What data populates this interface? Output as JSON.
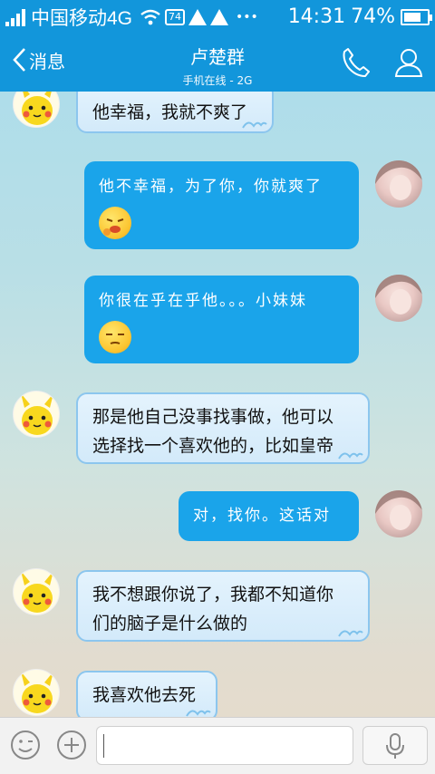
{
  "status_bar": {
    "carrier": "中国移动4G",
    "battery_icon_text": "74",
    "more": "•••",
    "time": "14:31",
    "battery_percent": "74%",
    "battery_level": 0.74
  },
  "header": {
    "back_label": "消息",
    "title": "卢楚群",
    "subtitle": "手机在线 - 2G"
  },
  "messages": [
    {
      "side": "left",
      "text": "他幸福，我就不爽了"
    },
    {
      "side": "right",
      "text": "他不幸福，为了你，你就爽了",
      "emoji": "pouting-emoji"
    },
    {
      "side": "right",
      "text": "你很在乎在乎他。。。小妹妹",
      "emoji": "unamused-emoji"
    },
    {
      "side": "left",
      "line1": "那是他自己没事找事做，他可以",
      "line2": "选择找一个喜欢他的，比如皇帝"
    },
    {
      "side": "right",
      "text": "对，找你。这话对"
    },
    {
      "side": "left",
      "line1": "我不想跟你说了，我都不知道你",
      "line2": "们的脑子是什么做的"
    },
    {
      "side": "left",
      "text": "我喜欢他去死"
    }
  ],
  "input": {
    "placeholder": ""
  },
  "colors": {
    "brand_blue": "#1296db",
    "right_bubble": "#1aa4ea",
    "left_bubble_border": "#8cc6ee"
  }
}
